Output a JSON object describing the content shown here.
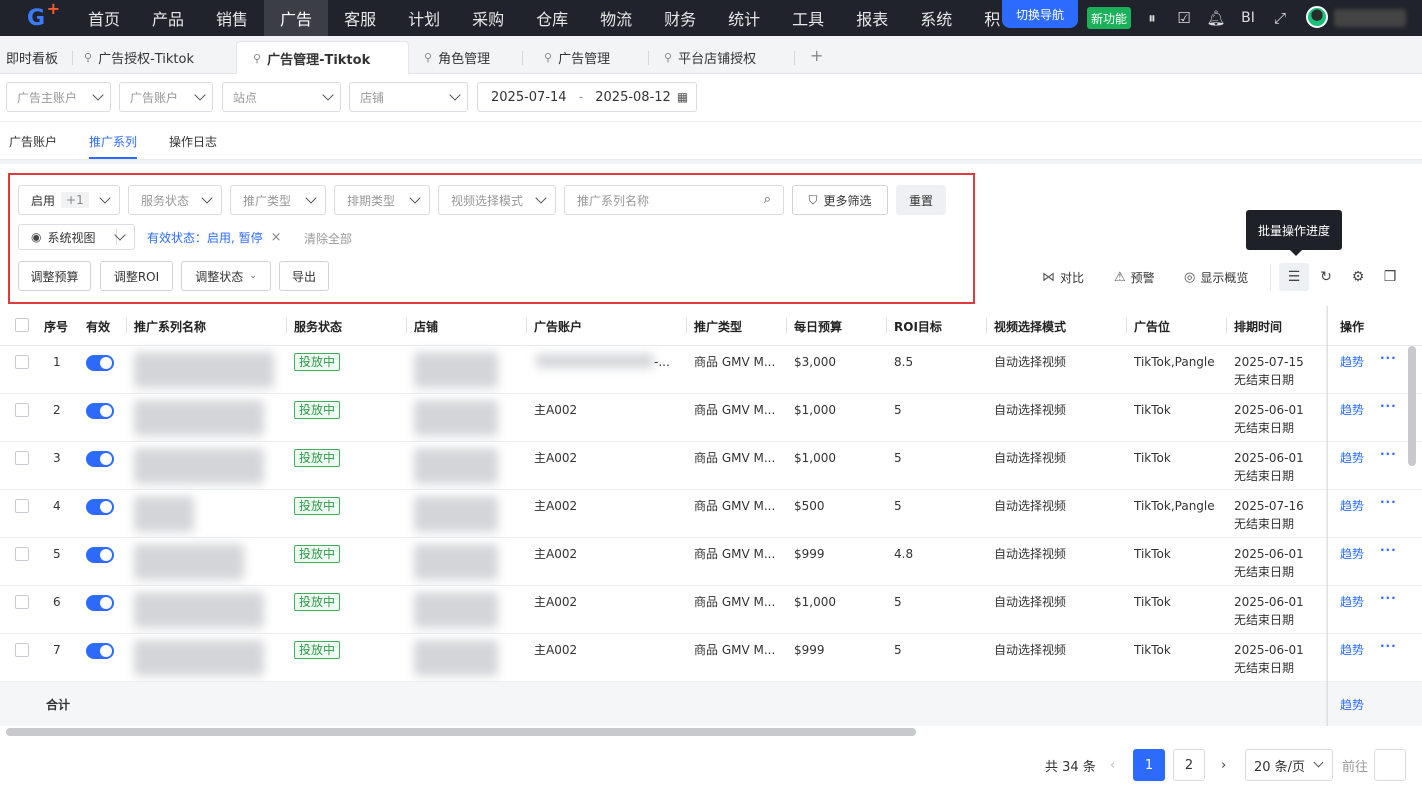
{
  "topnav": {
    "items": [
      "首页",
      "产品",
      "销售",
      "广告",
      "客服",
      "计划",
      "采购",
      "仓库",
      "物流",
      "财务",
      "统计",
      "工具",
      "报表",
      "系统",
      "积"
    ],
    "active_index": 3,
    "switch_nav": "切换导航",
    "new_feature": "新功能",
    "bi_label": "BI"
  },
  "tabs": [
    {
      "label": "即时看板",
      "pinned": false
    },
    {
      "label": "广告授权-Tiktok",
      "pinned": true
    },
    {
      "label": "广告管理-Tiktok",
      "pinned": true,
      "active": true
    },
    {
      "label": "角色管理",
      "pinned": true
    },
    {
      "label": "广告管理",
      "pinned": true
    },
    {
      "label": "平台店铺授权",
      "pinned": true
    }
  ],
  "filters": {
    "main_account": "广告主账户",
    "ad_account": "广告账户",
    "site": "站点",
    "store": "店铺",
    "date_start": "2025-07-14",
    "date_sep": "-",
    "date_end": "2025-08-12"
  },
  "subtabs": [
    "广告账户",
    "推广系列",
    "操作日志"
  ],
  "subtab_active": 1,
  "panel": {
    "status_filter": "启用",
    "status_badge": "+1",
    "service_status": "服务状态",
    "promo_type": "推广类型",
    "schedule_type": "排期类型",
    "video_mode": "视频选择模式",
    "search_placeholder": "推广系列名称",
    "more_filters": "更多筛选",
    "reset": "重置",
    "system_view": "系统视图",
    "active_tag": "有效状态：启用, 暂停",
    "clear_all": "清除全部",
    "adjust_budget": "调整预算",
    "adjust_roi": "调整ROI",
    "adjust_status": "调整状态",
    "export": "导出",
    "tooltip": "批量操作进度",
    "compare": "对比",
    "alert": "预警",
    "show_overview": "显示概览"
  },
  "table": {
    "headers": [
      "序号",
      "有效",
      "推广系列名称",
      "服务状态",
      "店铺",
      "广告账户",
      "推广类型",
      "每日预算",
      "ROI目标",
      "视频选择模式",
      "广告位",
      "排期时间",
      "操作"
    ],
    "rows": [
      {
        "no": "1",
        "status": "投放中",
        "account": "-...",
        "type": "商品 GMV M...",
        "budget": "$3,000",
        "roi": "8.5",
        "video": "自动选择视频",
        "placement": "TikTok,Pangle",
        "date": "2025-07-15",
        "end": "无结束日期",
        "action": "趋势"
      },
      {
        "no": "2",
        "status": "投放中",
        "account": "主A002",
        "type": "商品 GMV M...",
        "budget": "$1,000",
        "roi": "5",
        "video": "自动选择视频",
        "placement": "TikTok",
        "date": "2025-06-01",
        "end": "无结束日期",
        "action": "趋势"
      },
      {
        "no": "3",
        "status": "投放中",
        "account": "主A002",
        "type": "商品 GMV M...",
        "budget": "$1,000",
        "roi": "5",
        "video": "自动选择视频",
        "placement": "TikTok",
        "date": "2025-06-01",
        "end": "无结束日期",
        "action": "趋势"
      },
      {
        "no": "4",
        "status": "投放中",
        "account": "主A002",
        "type": "商品 GMV M...",
        "budget": "$500",
        "roi": "5",
        "video": "自动选择视频",
        "placement": "TikTok,Pangle",
        "date": "2025-07-16",
        "end": "无结束日期",
        "action": "趋势"
      },
      {
        "no": "5",
        "status": "投放中",
        "account": "主A002",
        "type": "商品 GMV M...",
        "budget": "$999",
        "roi": "4.8",
        "video": "自动选择视频",
        "placement": "TikTok",
        "date": "2025-06-01",
        "end": "无结束日期",
        "action": "趋势"
      },
      {
        "no": "6",
        "status": "投放中",
        "account": "主A002",
        "type": "商品 GMV M...",
        "budget": "$1,000",
        "roi": "5",
        "video": "自动选择视频",
        "placement": "TikTok",
        "date": "2025-06-01",
        "end": "无结束日期",
        "action": "趋势"
      },
      {
        "no": "7",
        "status": "投放中",
        "account": "主A002",
        "type": "商品 GMV M...",
        "budget": "$999",
        "roi": "5",
        "video": "自动选择视频",
        "placement": "TikTok",
        "date": "2025-06-01",
        "end": "无结束日期",
        "action": "趋势"
      }
    ],
    "sum_label": "合计",
    "sum_action": "趋势"
  },
  "pagination": {
    "total": "共 34 条",
    "prev": "‹",
    "pages": [
      "1",
      "2"
    ],
    "next": "›",
    "page_size": "20 条/页",
    "goto": "前往"
  },
  "colors": {
    "accent": "#2d6bff",
    "nav_bg": "#20232b",
    "success": "#3cb15a",
    "highlight": "#e23b3b"
  }
}
